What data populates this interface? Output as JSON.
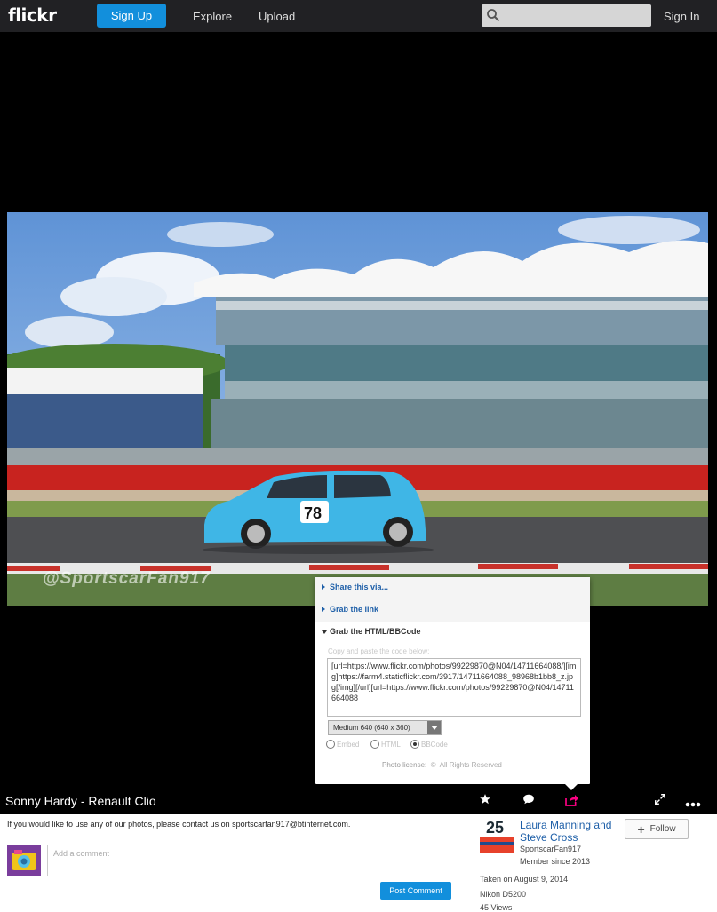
{
  "header": {
    "logo": "flickr",
    "signup_label": "Sign Up",
    "nav": [
      "Explore",
      "Upload"
    ],
    "signin_label": "Sign In",
    "search_placeholder": ""
  },
  "photo": {
    "watermark": "@SportscarFan917",
    "title": "Sonny Hardy - Renault Clio"
  },
  "share_popup": {
    "share_via": "Share this via...",
    "grab_link": "Grab the link",
    "grab_html": "Grab the HTML/BBCode",
    "copy_hint": "Copy and paste the code below:",
    "code": "[url=https://www.flickr.com/photos/99229870@N04/14711664088/][img]https://farm4.staticflickr.com/3917/14711664088_98968b1bb8_z.jpg[/img][/url][url=https://www.flickr.com/photos/99229870@N04/14711664088",
    "size_option": "Medium 640 (640 x 360)",
    "formats": [
      "Embed",
      "HTML",
      "BBCode"
    ],
    "selected_format": "BBCode",
    "license_label": "Photo license:",
    "license_value": "All Rights Reserved"
  },
  "description": "If you would like to use any of our photos, please contact us on sportscarfan917@btinternet.com.",
  "comment": {
    "placeholder": "Add a comment",
    "post_label": "Post Comment"
  },
  "owner": {
    "name": "Laura Manning and Steve Cross",
    "username": "SportscarFan917",
    "member_since": "Member since 2013",
    "follow_label": "Follow",
    "buddy_number": "25"
  },
  "info": {
    "taken": "Taken on August 9, 2014",
    "camera": "Nikon D5200",
    "views": "45 Views"
  },
  "colors": {
    "accent": "#128fdc",
    "topbar": "#212124",
    "share_active": "#ff0084"
  }
}
